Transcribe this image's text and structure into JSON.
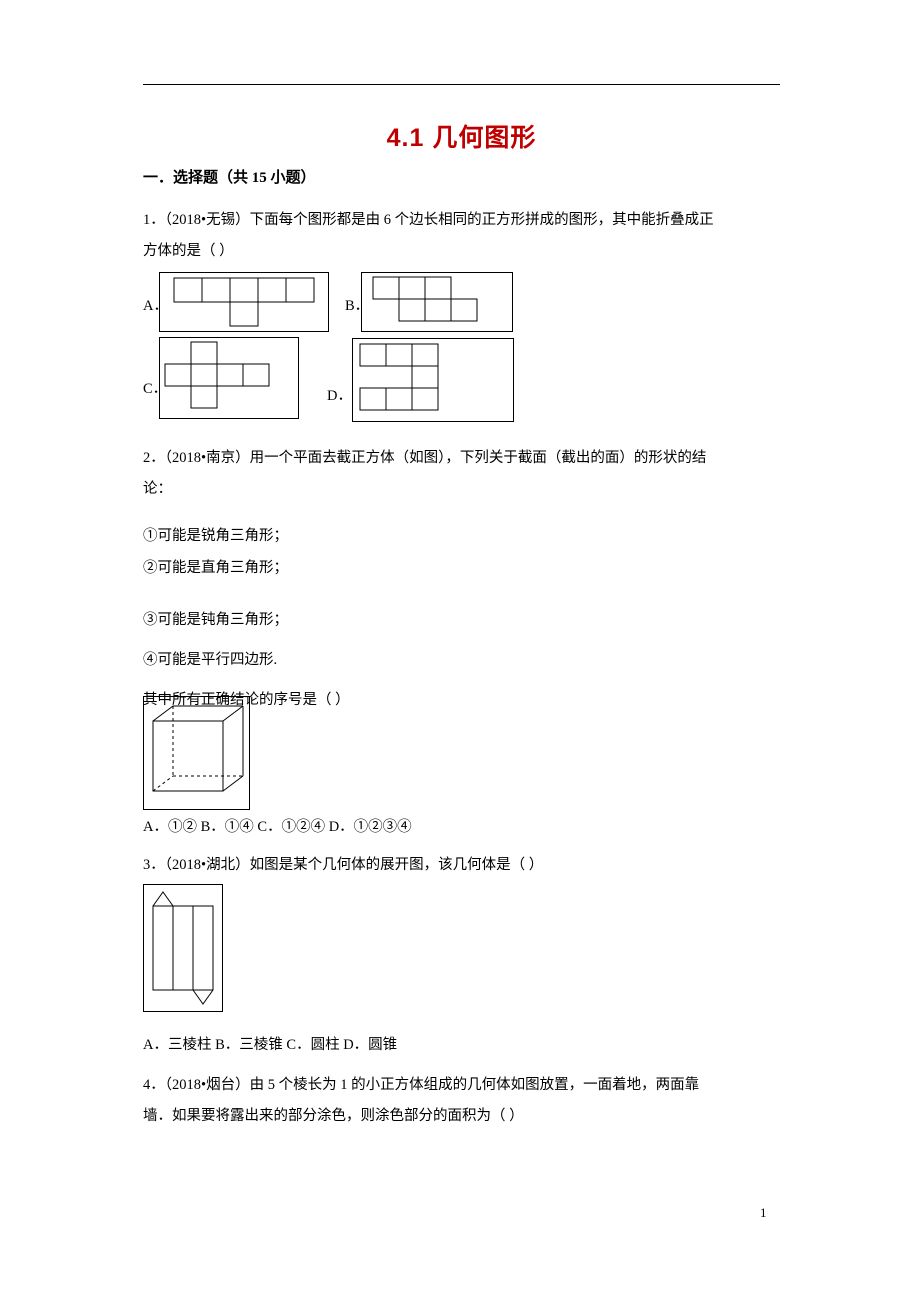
{
  "document": {
    "title": "4.1 几何图形",
    "section_heading": "一．选择题（共 15 小题）",
    "page_number": "1"
  },
  "questions": [
    {
      "number": "1．",
      "source": "（2018•无锡）",
      "text_line1": "1．（2018•无锡）下面每个图形都是由 6 个边长相同的正方形拼成的图形，其中能折叠成正",
      "text_line2": "方体的是（      ）",
      "choice_labels": [
        "A．",
        "B．",
        "C．",
        "D．"
      ]
    },
    {
      "number": "2．",
      "text_line1": "2．（2018•南京）用一个平面去截正方体（如图），下列关于截面（截出的面）的形状的结",
      "text_line2": "论：",
      "items": [
        "①可能是锐角三角形；",
        "②可能是直角三角形；",
        "③可能是钝角三角形；",
        "④可能是平行四边形."
      ],
      "prompt": "其中所有正确结论的序号是（      ）",
      "answers": "A．①②  B．①④  C．①②④    D．①②③④"
    },
    {
      "number": "3．",
      "text_line1": "3．（2018•湖北）如图是某个几何体的展开图，该几何体是（      ）",
      "answers": "A．三棱柱     B．三棱锥     C．圆柱  D．圆锥"
    },
    {
      "number": "4．",
      "text_line1": "4．（2018•烟台）由 5 个棱长为 1 的小正方体组成的几何体如图放置，一面着地，两面靠",
      "text_line2": "墙．如果要将露出来的部分涂色，则涂色部分的面积为（      ）"
    }
  ],
  "colors": {
    "title": "#c00000",
    "text": "#000000",
    "figure_stroke": "#000000"
  }
}
